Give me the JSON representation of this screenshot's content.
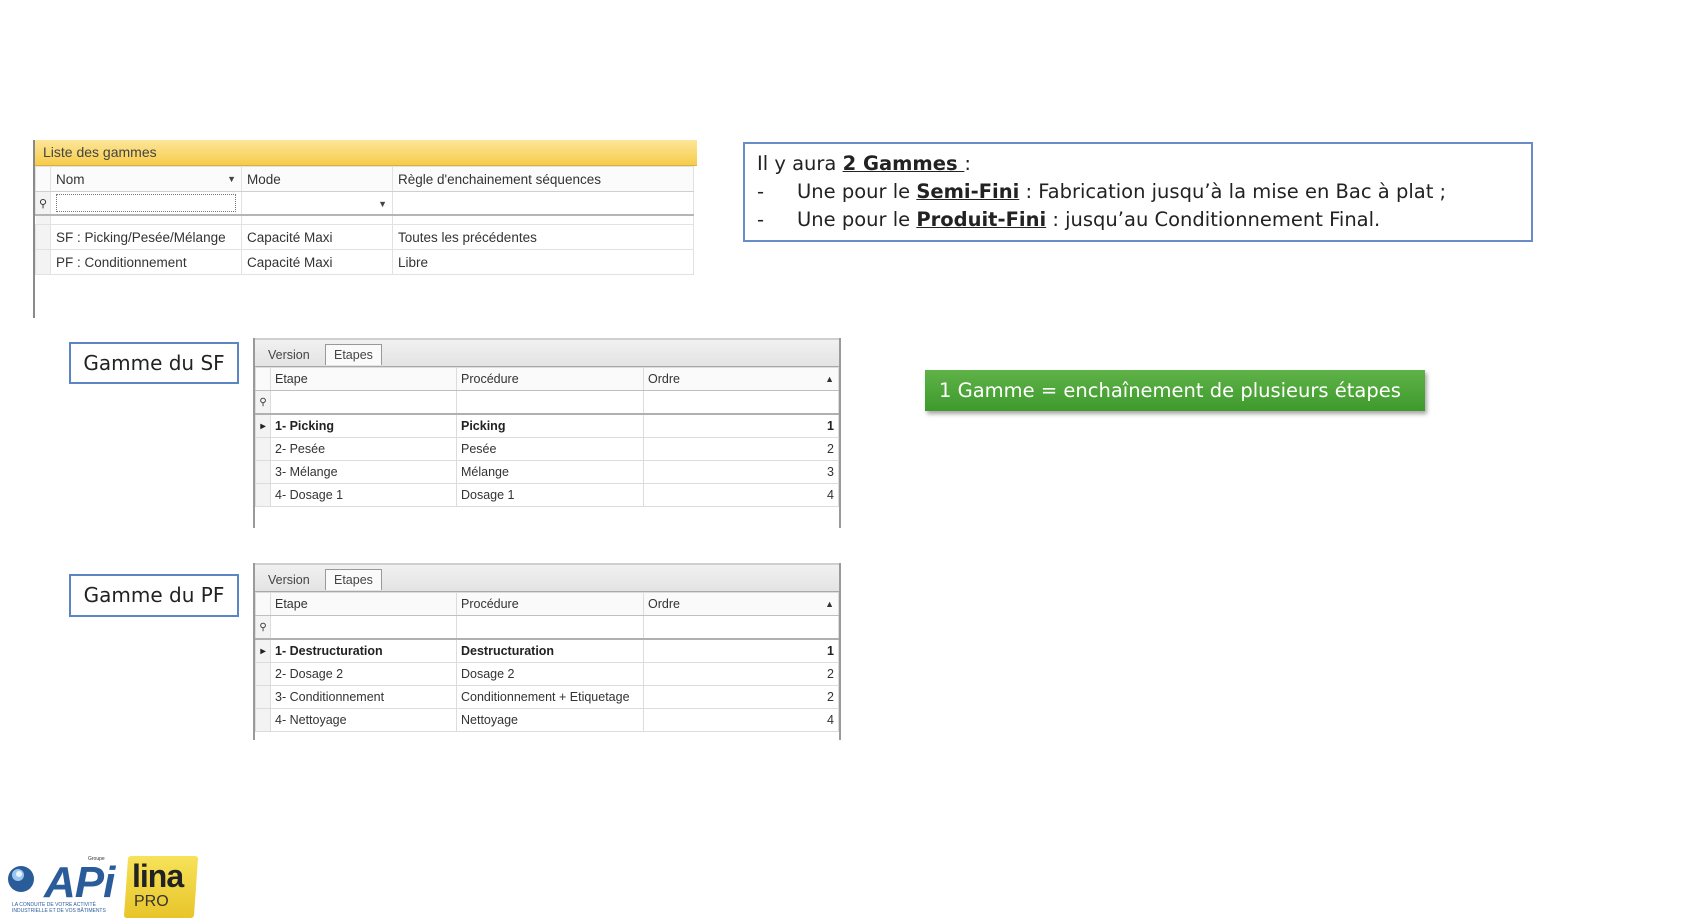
{
  "liste": {
    "title": "Liste des gammes",
    "columns": [
      "Nom",
      "Mode",
      "Règle d'enchainement séquences"
    ],
    "rows": [
      [
        "SF : Picking/Pesée/Mélange",
        "Capacité Maxi",
        "Toutes les précédentes"
      ],
      [
        "PF : Conditionnement",
        "Capacité Maxi",
        "Libre"
      ]
    ]
  },
  "info": {
    "intro": "Il y aura ",
    "intro_bold": "2 Gammes ",
    "intro_end": ":",
    "dash": "-",
    "line1_pre": "Une pour le ",
    "line1_bold": "Semi-Fini",
    "line1_post": " : Fabrication jusqu’à la mise en Bac à plat ;",
    "line2_pre": "Une pour le ",
    "line2_bold": "Produit-Fini",
    "line2_post": " : jusqu’au Conditionnement Final."
  },
  "green_box": {
    "text": "1 Gamme = enchaînement de plusieurs étapes"
  },
  "sf": {
    "label": "Gamme du SF",
    "tabs": [
      "Version",
      "Etapes"
    ],
    "columns": [
      "Etape",
      "Procédure",
      "Ordre"
    ],
    "rows": [
      [
        "1- Picking",
        "Picking",
        "1"
      ],
      [
        "2- Pesée",
        "Pesée",
        "2"
      ],
      [
        "3- Mélange",
        "Mélange",
        "3"
      ],
      [
        "4- Dosage 1",
        "Dosage 1",
        "4"
      ]
    ]
  },
  "pf": {
    "label": "Gamme du PF",
    "tabs": [
      "Version",
      "Etapes"
    ],
    "columns": [
      "Etape",
      "Procédure",
      "Ordre"
    ],
    "rows": [
      [
        "1- Destructuration",
        "Destructuration",
        "1"
      ],
      [
        "2- Dosage 2",
        "Dosage 2",
        "2"
      ],
      [
        "3- Conditionnement",
        "Conditionnement + Etiquetage",
        "2"
      ],
      [
        "4- Nettoyage",
        "Nettoyage",
        "4"
      ]
    ]
  },
  "logos": {
    "api": "APi",
    "api_small": "Groupe",
    "api_tag": "LA CONDUITE DE VOTRE ACTIVITÉ INDUSTRIELLE ET DE VOS BÂTIMENTS",
    "lina": "lina",
    "lina_pro": "PRO"
  }
}
